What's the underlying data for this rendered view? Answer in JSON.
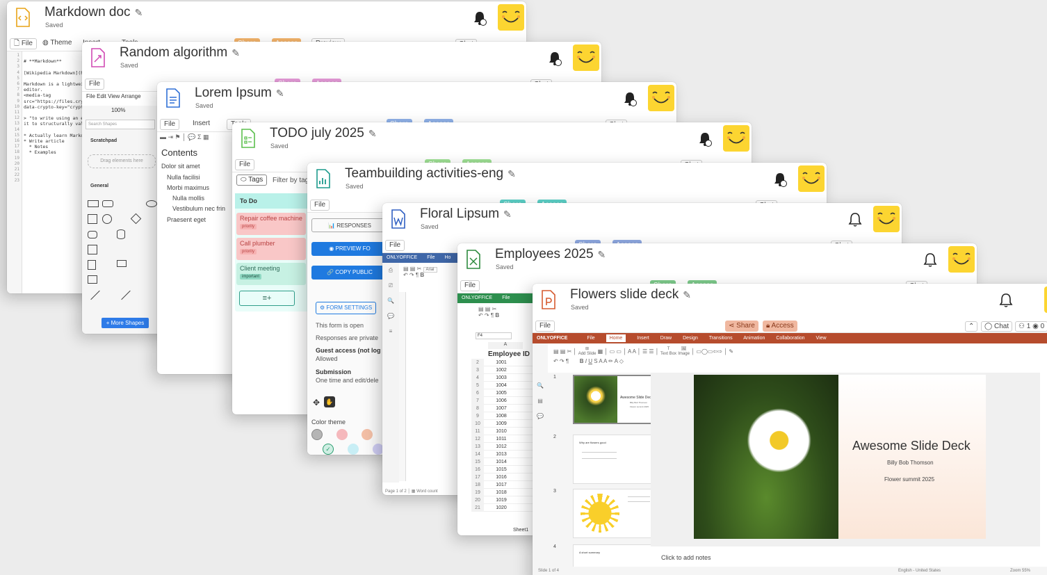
{
  "common": {
    "saved": "Saved",
    "file": "File",
    "share": "Share",
    "access": "Access",
    "chat": "Chat",
    "users": "1",
    "viewers": "0",
    "bell_count": "1"
  },
  "markdown": {
    "title": "Markdown doc",
    "theme": "Theme",
    "insert": "Insert",
    "tools": "Tools",
    "preview": "Preview",
    "line_numbers": "1\n2\n3\n4\n5\n6\n7\n8\n9\n10\n11\n12\n13\n14\n15\n16\n17\n18\n19\n20\n21\n22\n23",
    "code": "\n# **Markdown**\n\n[Wikipedia Markdown](h\n\nMarkdown is a lightwei\neditor.\n<media-tag\nsrc=\"https://files.cry\ndata-crypto-key=\"crypt\n\n> \"to write using an e\nit to structurally val\n\n* Actually learn Markd\n* Write article\n  * Notes\n  * Examples"
  },
  "drawio": {
    "title": "Random algorithm",
    "menu": "File   Edit   View   Arrange",
    "zoom": "100%",
    "search": "Search Shapes",
    "scratchpad": "Scratchpad",
    "drag": "Drag elements here",
    "general": "General",
    "more_shapes": "+ More Shapes"
  },
  "doc": {
    "title": "Lorem Ipsum",
    "insert": "Insert",
    "tools": "Tools",
    "contents": "Contents",
    "toc": [
      "Dolor sit amet",
      "Nulla facilisi",
      "Morbi maximus",
      "Nulla mollis",
      "Vestibulum nec frin",
      "Praesent eget"
    ]
  },
  "kanban": {
    "title": "TODO july 2025",
    "tags": "Tags",
    "filter": "Filter by tag",
    "column": "To Do",
    "cards": [
      {
        "title": "Repair coffee machine",
        "tag": "priority"
      },
      {
        "title": "Call plumber",
        "tag": "priority"
      },
      {
        "title": "Client meeting",
        "tag": "important"
      }
    ]
  },
  "form": {
    "title": "Teambuilding activities-eng",
    "responses": "RESPONSES",
    "preview": "PREVIEW FO",
    "copy": "COPY PUBLIC",
    "settings": "FORM SETTINGS",
    "open": "This form is open",
    "private": "Responses are private",
    "guest_label": "Guest access (not log",
    "guest_value": "Allowed",
    "submission_label": "Submission",
    "submission_value": "One time and edit/dele",
    "color_theme": "Color theme",
    "colors": {
      "grey": "#b5b5b5",
      "pink": "#f5b8bc",
      "peach": "#f3bfa6",
      "mint": "#cfeee3",
      "teal": "#c8eef5",
      "lav": "#cfcdf3"
    }
  },
  "word": {
    "title": "Floral Lipsum",
    "brand": "ONLYOFFICE",
    "file": "File",
    "home": "Ho",
    "font": "Arial",
    "page": "Page 1 of 2",
    "wordcount": "Word count"
  },
  "sheet": {
    "title": "Employees 2025",
    "brand": "ONLYOFFICE",
    "file": "File",
    "cell": "F4",
    "col": "A",
    "header": "Employee ID",
    "rows": [
      "1001",
      "1002",
      "1003",
      "1004",
      "1005",
      "1006",
      "1007",
      "1008",
      "1009",
      "1010",
      "1011",
      "1012",
      "1013",
      "1014",
      "1015",
      "1016",
      "1017",
      "1018",
      "1019",
      "1020"
    ],
    "tab": "Sheet1"
  },
  "slides": {
    "title": "Flowers slide deck",
    "brand": "ONLYOFFICE",
    "menu": [
      "File",
      "Home",
      "Insert",
      "Draw",
      "Design",
      "Transitions",
      "Animation",
      "Collaboration",
      "View"
    ],
    "main_title": "Awesome Slide Deck",
    "author": "Billy Bob Thomson",
    "event": "Flower summit 2025",
    "thumb2": "Why are flowers good",
    "thumb4": "A short summary",
    "notes": "Click to add notes",
    "status": "Slide 1 of 4",
    "lang": "English - United States",
    "zoom": "Zoom 55%",
    "add_slide": "Add Slide",
    "text_box": "Text Box",
    "image": "Image"
  }
}
